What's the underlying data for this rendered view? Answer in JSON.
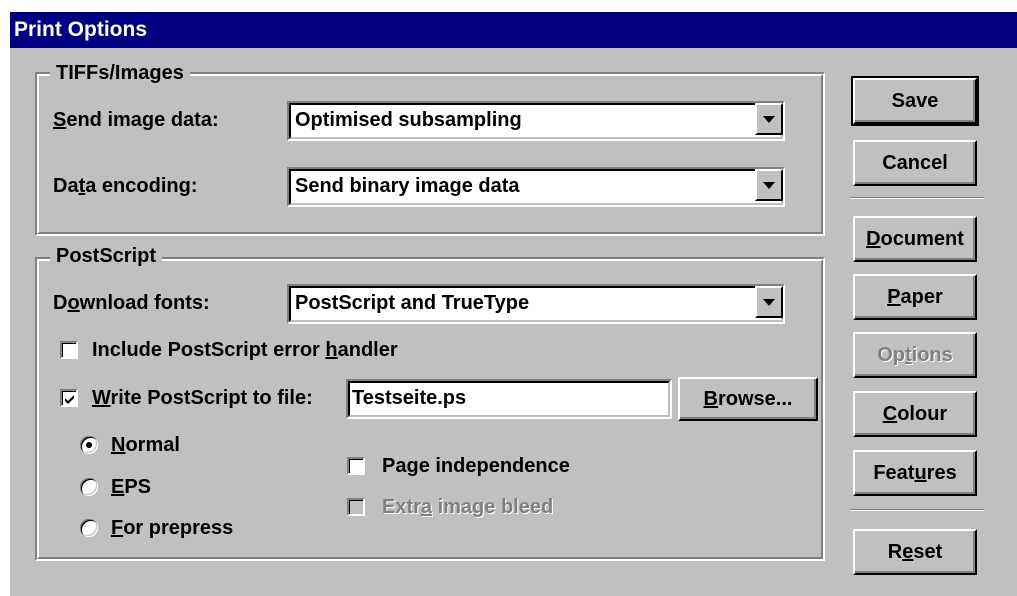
{
  "window": {
    "title": "Print Options"
  },
  "tiffs": {
    "legend": "TIFFs/Images",
    "send_image_data": {
      "label_pre": "",
      "label_key": "S",
      "label_post": "end image data:",
      "value": "Optimised subsampling"
    },
    "data_encoding": {
      "label_pre": "Da",
      "label_key": "t",
      "label_post": "a encoding:",
      "value": "Send binary image data"
    }
  },
  "postscript": {
    "legend": "PostScript",
    "download_fonts": {
      "label_pre": "D",
      "label_key": "o",
      "label_post": "wnload fonts:",
      "value": "PostScript and TrueType"
    },
    "error_handler": {
      "label_pre": "Include PostScript error ",
      "label_key": "h",
      "label_post": "andler",
      "checked": false
    },
    "write_to_file": {
      "label_pre": "",
      "label_key": "W",
      "label_post": "rite PostScript to file:",
      "checked": true,
      "filename": "Testseite.ps"
    },
    "browse": {
      "label_pre": "",
      "label_key": "B",
      "label_post": "rowse..."
    },
    "modes": [
      {
        "label_pre": "",
        "label_key": "N",
        "label_post": "ormal",
        "selected": true
      },
      {
        "label_pre": "",
        "label_key": "E",
        "label_post": "PS",
        "selected": false
      },
      {
        "label_pre": "",
        "label_key": "F",
        "label_post": "or prepress",
        "selected": false
      }
    ],
    "page_independence": {
      "label_pre": "Pa",
      "label_key": "g",
      "label_post": "e independence",
      "checked": false
    },
    "extra_image_bleed": {
      "label_pre": "Extr",
      "label_key": "a",
      "label_post": " image bleed",
      "checked": false,
      "disabled": true
    }
  },
  "buttons": {
    "save": {
      "label_pre": "Save",
      "label_key": "",
      "label_post": ""
    },
    "cancel": {
      "label_pre": "Cancel",
      "label_key": "",
      "label_post": ""
    },
    "document": {
      "label_pre": "",
      "label_key": "D",
      "label_post": "ocument"
    },
    "paper": {
      "label_pre": "",
      "label_key": "P",
      "label_post": "aper"
    },
    "options": {
      "label_pre": "Op",
      "label_key": "t",
      "label_post": "ions",
      "disabled": true
    },
    "colour": {
      "label_pre": "",
      "label_key": "C",
      "label_post": "olour"
    },
    "features": {
      "label_pre": "Feat",
      "label_key": "u",
      "label_post": "res"
    },
    "reset": {
      "label_pre": "R",
      "label_key": "e",
      "label_post": "set"
    }
  },
  "colors": {
    "titlebar": "#000080",
    "face": "#c0c0c0",
    "shadow": "#808080",
    "highlight": "#ffffff"
  },
  "icons": {
    "checkmark": "checkmark-icon",
    "dropdown": "chevron-down-icon",
    "radio": "radio-dot-icon"
  }
}
